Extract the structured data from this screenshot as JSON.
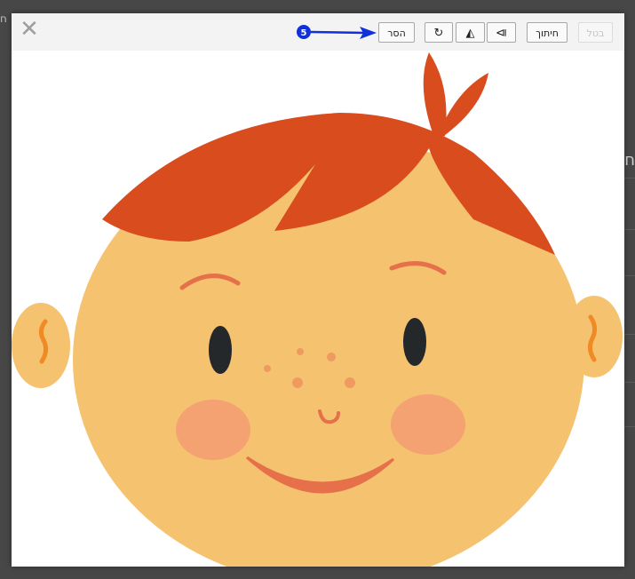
{
  "toolbar": {
    "close_glyph": "✕",
    "cancel_label": "בטל",
    "crop_label": "חיתוך",
    "remove_label": "הסר",
    "rotate_glyph": "↻",
    "flip_v_glyph": "◭",
    "flip_h_glyph": "⧐"
  },
  "annotation": {
    "badge_number": "5",
    "color": "#1030d8"
  },
  "background": {
    "right_char": "ח",
    "left_char": "ח"
  },
  "image": {
    "description_colors": {
      "hair": "#d94c1e",
      "skin": "#f5c270",
      "cheek": "#f4a272",
      "mouth": "#e5704a",
      "eye": "#25282b",
      "ear_inner": "#ef8a25"
    }
  }
}
